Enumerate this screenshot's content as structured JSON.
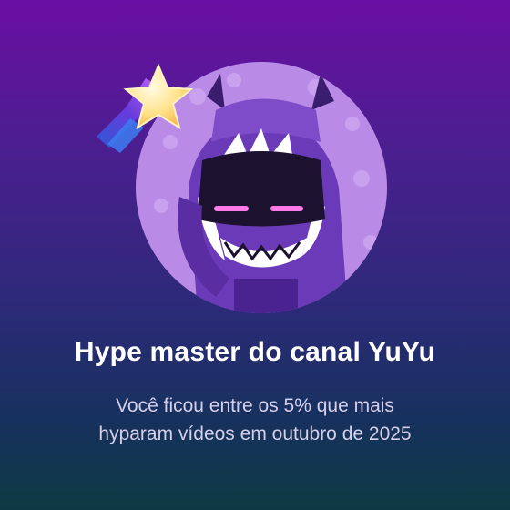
{
  "achievement": {
    "title": "Hype master do canal YuYu",
    "subtitle_line1": "Você ficou entre os 5% que mais",
    "subtitle_line2": "hyparam vídeos em outubro de 2025"
  },
  "icons": {
    "badge": "shooting-star-icon",
    "avatar": "channel-avatar"
  },
  "colors": {
    "background_top": "#6a0fa3",
    "background_bottom": "#0d3a42",
    "avatar_circle": "#b98be6",
    "star": "#ffe28a"
  }
}
